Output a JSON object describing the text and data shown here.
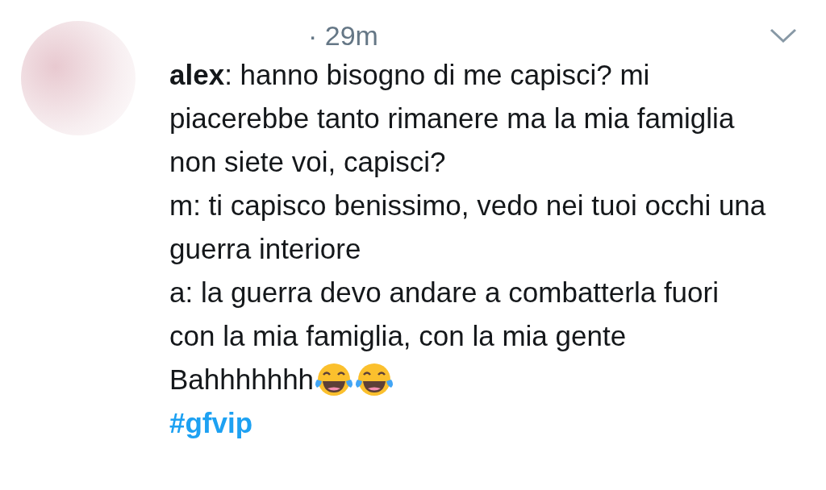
{
  "tweet": {
    "time": "· 29m",
    "paragraphs": [
      "**alex**: hanno bisogno di me capisci? mi piacerebbe tanto rimanere ma la mia famiglia non siete voi, capisci?",
      "m: ti capisco benissimo, vedo nei tuoi occhi una guerra interiore",
      "a: la guerra devo andare a combatterla fuori con la mia famiglia, con la mia gente",
      "Bahhhhhhh"
    ],
    "hashtag": "#gfvip"
  }
}
